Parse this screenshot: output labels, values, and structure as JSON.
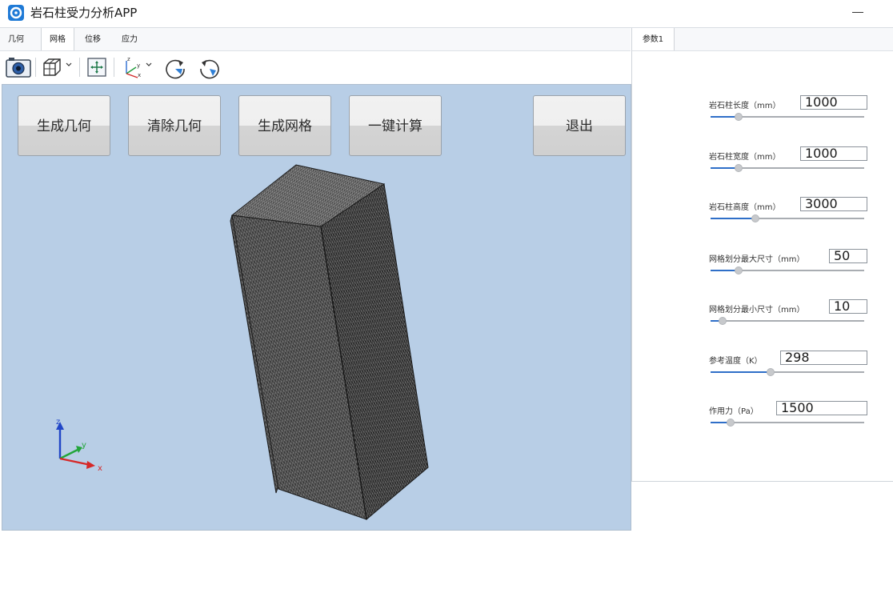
{
  "app": {
    "title": "岩石柱受力分析APP"
  },
  "menu_tabs": [
    "几何",
    "网格",
    "位移",
    "应力"
  ],
  "menu_active_index": 1,
  "toolbar_icons": [
    "camera-icon",
    "view-cube-icon",
    "dropdown-arrow-icon",
    "zoom-extents-icon",
    "axis-view-icon",
    "dropdown-arrow-icon",
    "rotate-right-icon",
    "rotate-left-icon"
  ],
  "buttons": {
    "generate_geometry": "生成几何",
    "clear_geometry": "清除几何",
    "generate_mesh": "生成网格",
    "compute_all": "一键计算",
    "exit": "退出"
  },
  "axis_labels": {
    "x": "x",
    "y": "y",
    "z": "z"
  },
  "right_tab": "参数1",
  "params": [
    {
      "label": "岩石柱长度（mm）",
      "value": "1000",
      "slider": 0.18
    },
    {
      "label": "岩石柱宽度（mm）",
      "value": "1000",
      "slider": 0.18
    },
    {
      "label": "岩石柱高度（mm）",
      "value": "3000",
      "slider": 0.29
    },
    {
      "label": "网格划分最大尺寸（mm）",
      "value": "50",
      "slider": 0.18
    },
    {
      "label": "网格划分最小尺寸（mm）",
      "value": "10",
      "slider": 0.08
    },
    {
      "label": "参考温度（K）",
      "value": "298",
      "slider": 0.39
    },
    {
      "label": "作用力（Pa）",
      "value": "1500",
      "slider": 0.13
    }
  ],
  "colors": {
    "viewport_bg": "#b8cee6",
    "accent": "#2f6fc8",
    "mesh": "#2b2b2b"
  }
}
